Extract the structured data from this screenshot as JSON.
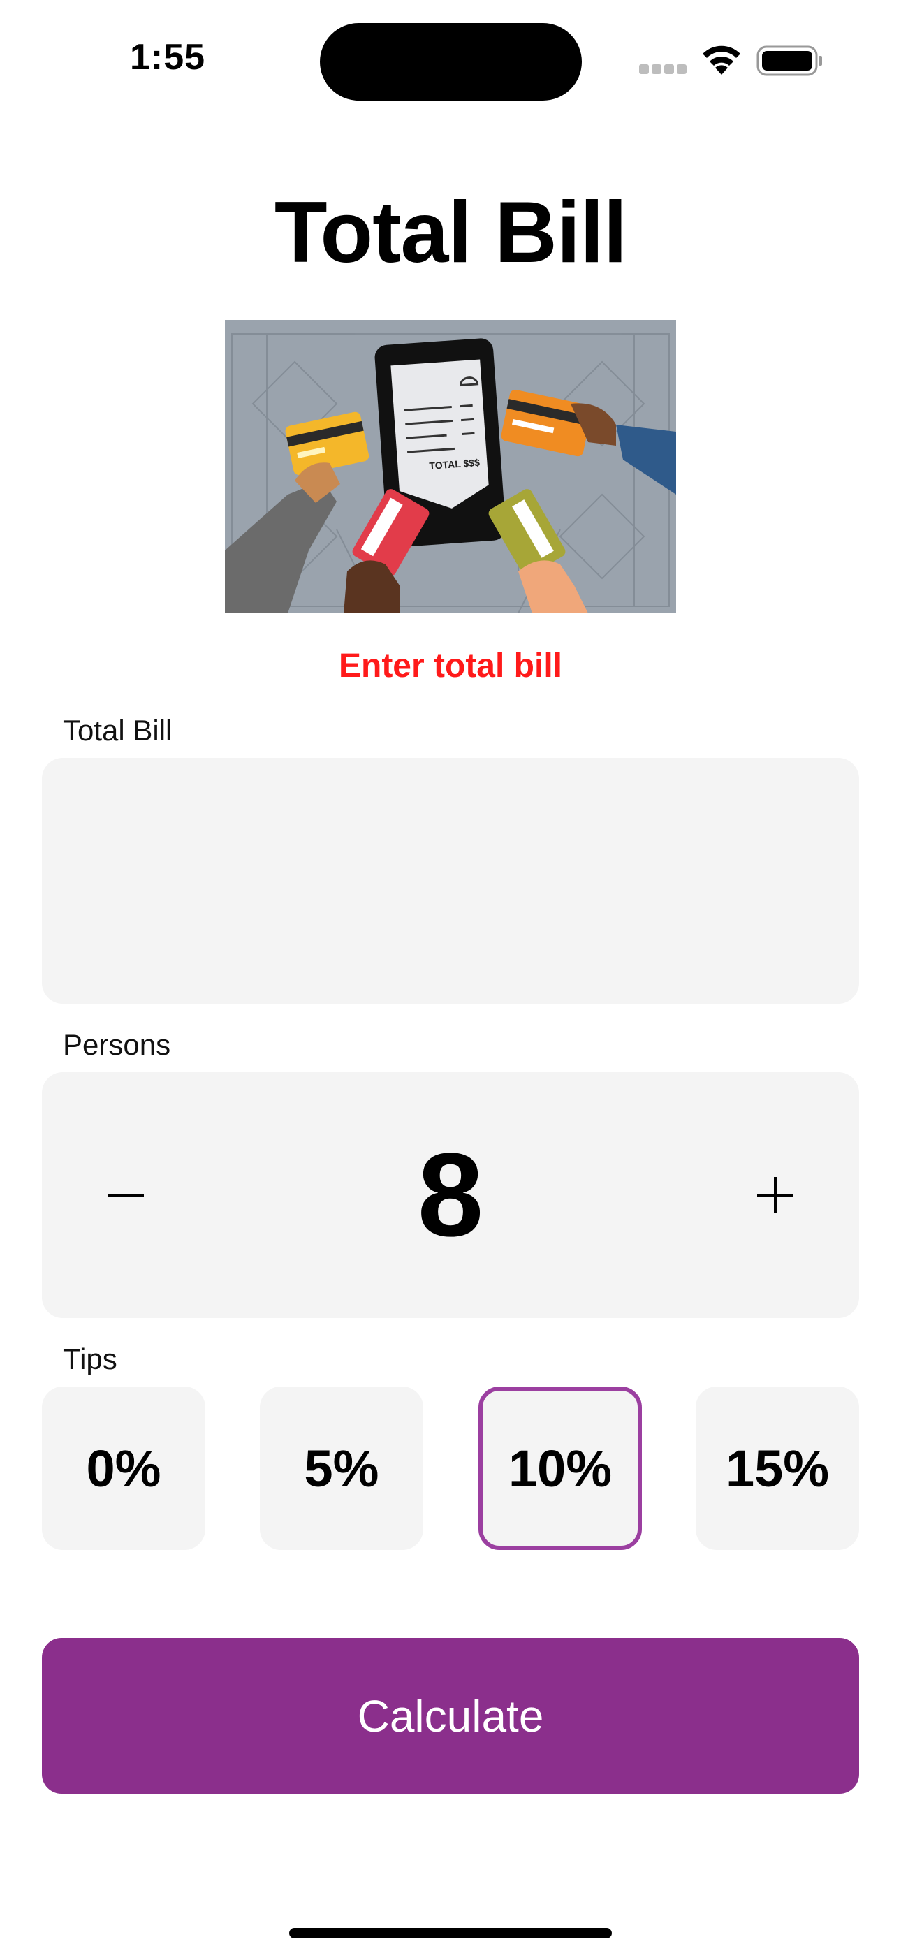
{
  "status_bar": {
    "time": "1:55"
  },
  "title": "Total Bill",
  "illustration": {
    "receipt_total": "TOTAL $$$"
  },
  "error_message": "Enter total bill",
  "bill": {
    "label": "Total Bill",
    "value": "",
    "placeholder": ""
  },
  "persons": {
    "label": "Persons",
    "value": "8",
    "decrement_symbol": "−",
    "increment_symbol": "+"
  },
  "tips": {
    "label": "Tips",
    "options": [
      "0%",
      "5%",
      "10%",
      "15%"
    ],
    "selected": "10%"
  },
  "calculate_label": "Calculate",
  "colors": {
    "accent": "#8b2f8c",
    "selected_border": "#9b3fa0",
    "error": "#ff1a1a",
    "panel": "#f4f4f4"
  }
}
